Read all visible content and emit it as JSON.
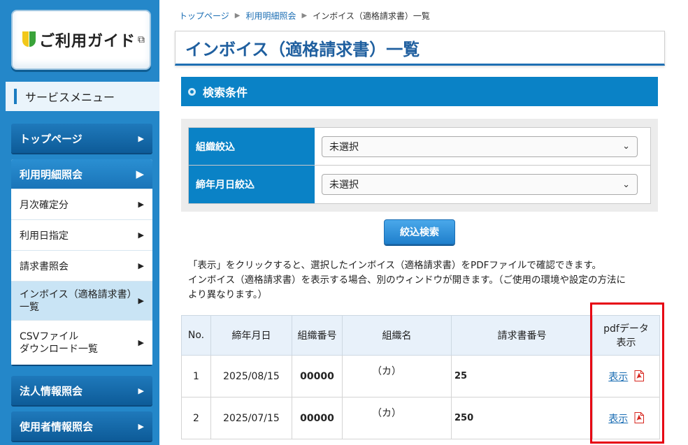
{
  "sidebar": {
    "guide_label": "ご利用ガイド",
    "service_menu": "サービスメニュー",
    "items": {
      "top": "トップページ",
      "statement": "利用明細照会",
      "monthly": "月次確定分",
      "by_date": "利用日指定",
      "bill": "請求書照会",
      "invoice_1": "インボイス（適格請求書）",
      "invoice_2": "一覧",
      "csv_1": "CSVファイル",
      "csv_2": "ダウンロード一覧",
      "corp": "法人情報照会",
      "user": "使用者情報照会"
    }
  },
  "breadcrumb": {
    "home": "トップページ",
    "parent": "利用明細照会",
    "current": "インボイス（適格請求書）一覧"
  },
  "page_title": "インボイス（適格請求書）一覧",
  "search": {
    "section_title": "検索条件",
    "org_label": "組織絞込",
    "org_value": "未選択",
    "date_label": "締年月日絞込",
    "date_value": "未選択",
    "button": "絞込検索"
  },
  "notice": {
    "line1": "「表示」をクリックすると、選択したインボイス（適格請求書）をPDFファイルで確認できます。",
    "line2": "インボイス（適格請求書）を表示する場合、別のウィンドウが開きます。（ご使用の環境や設定の方法に",
    "line3": "より異なります。）"
  },
  "table": {
    "headers": {
      "no": "No.",
      "date": "締年月日",
      "code": "組織番号",
      "org": "組織名",
      "invoice": "請求書番号",
      "pdf_1": "pdfデータ",
      "pdf_2": "表示"
    },
    "rows": [
      {
        "no": "1",
        "date": "2025/08/15",
        "code": "00000",
        "org": "（カ）",
        "invoice": "25",
        "pdf": "表示"
      },
      {
        "no": "2",
        "date": "2025/07/15",
        "code": "00000",
        "org": "（カ）",
        "invoice": "250",
        "pdf": "表示"
      }
    ]
  },
  "colors": {
    "primary": "#0a82c6",
    "sidebar": "#2487c9",
    "highlight": "#e60012",
    "pdf_icon": "#d7261e"
  },
  "icons": [
    "beginner-leaf-icon",
    "external-window-icon",
    "chevron-right-icon",
    "chevron-down-icon",
    "pdf-file-icon"
  ]
}
